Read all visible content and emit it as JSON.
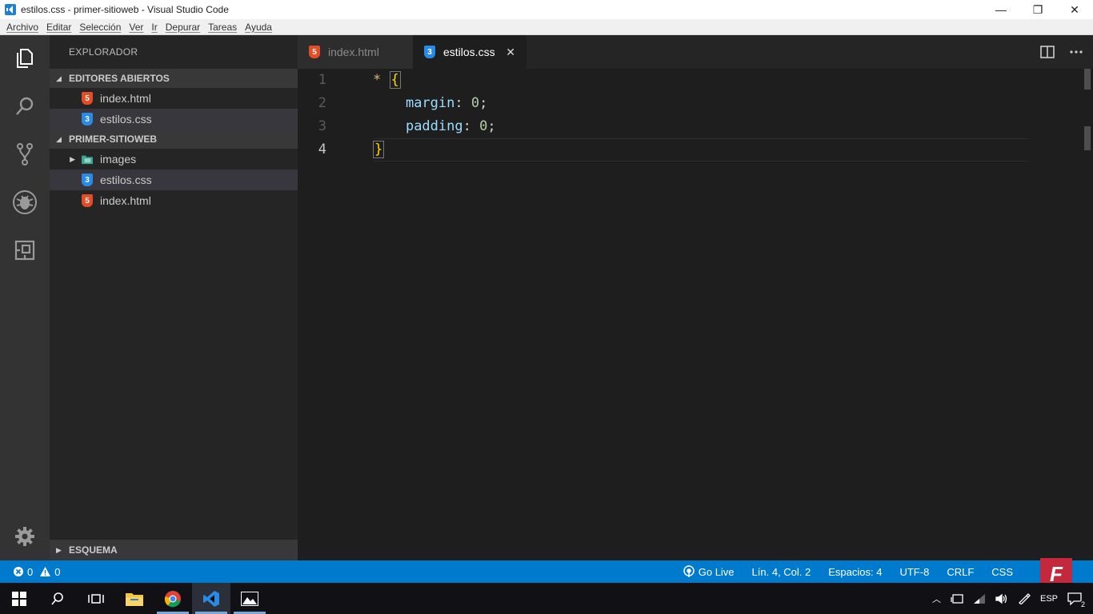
{
  "window": {
    "title": "estilos.css - primer-sitioweb - Visual Studio Code",
    "minimize": "—",
    "maximize": "❐",
    "close": "✕"
  },
  "menu": [
    "Archivo",
    "Editar",
    "Selección",
    "Ver",
    "Ir",
    "Depurar",
    "Tareas",
    "Ayuda"
  ],
  "activity": {
    "icons": [
      "files-icon",
      "search-icon",
      "source-control-icon",
      "debug-icon",
      "extensions-icon"
    ],
    "settings": "gear-icon"
  },
  "sidebar": {
    "title": "EXPLORADOR",
    "open_editors": {
      "header": "EDITORES ABIERTOS",
      "items": [
        {
          "name": "index.html",
          "type": "html"
        },
        {
          "name": "estilos.css",
          "type": "css"
        }
      ]
    },
    "project": {
      "header": "PRIMER-SITIOWEB",
      "items": [
        {
          "name": "images",
          "type": "folder"
        },
        {
          "name": "estilos.css",
          "type": "css"
        },
        {
          "name": "index.html",
          "type": "html"
        }
      ]
    },
    "outline": "ESQUEMA"
  },
  "tabs": [
    {
      "label": "index.html",
      "type": "html",
      "active": false
    },
    {
      "label": "estilos.css",
      "type": "css",
      "active": true
    }
  ],
  "editor": {
    "line_numbers": [
      "1",
      "2",
      "3",
      "4"
    ],
    "lines": [
      {
        "selector": "*",
        "brace": "{"
      },
      {
        "prop": "margin",
        "value": "0"
      },
      {
        "prop": "padding",
        "value": "0"
      },
      {
        "brace": "}"
      }
    ],
    "current_line": 4
  },
  "statusbar": {
    "errors": "0",
    "warnings": "0",
    "go_live": "Go Live",
    "position": "Lín. 4, Col. 2",
    "spaces": "Espacios: 4",
    "encoding": "UTF-8",
    "eol": "CRLF",
    "language": "CSS"
  },
  "badge": "F",
  "tray": {
    "language": "ESP",
    "notifications": "2"
  },
  "colors": {
    "accent": "#007acc",
    "html_icon": "#e44d26",
    "css_icon": "#2a8be6"
  }
}
